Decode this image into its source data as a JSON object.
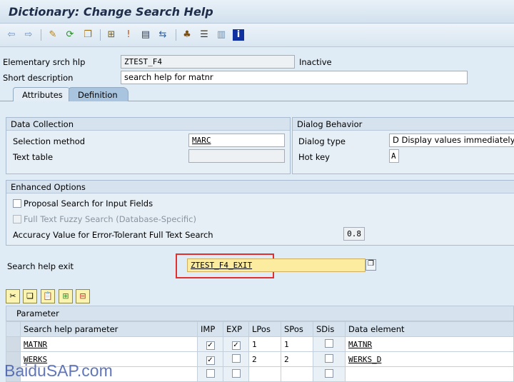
{
  "window": {
    "title": "Dictionary: Change Search Help"
  },
  "toolbar": {
    "icons": [
      "back-icon",
      "forward-icon",
      "edit-icon",
      "activate-icon",
      "copy-object-icon",
      "where-used-icon",
      "check-icon",
      "display-object-list-icon",
      "navigate-icon",
      "hierarchy-icon",
      "stack-icon",
      "layout-icon",
      "info-icon"
    ]
  },
  "header": {
    "name_label": "Elementary srch hlp",
    "name_value": "ZTEST_F4",
    "status": "Inactive",
    "desc_label": "Short description",
    "desc_value": "search help for matnr"
  },
  "tabs": [
    {
      "label": "Attributes",
      "active": false
    },
    {
      "label": "Definition",
      "active": true
    }
  ],
  "data_collection": {
    "title": "Data Collection",
    "selection_method_label": "Selection method",
    "selection_method_value": "MARC",
    "text_table_label": "Text table",
    "text_table_value": ""
  },
  "dialog_behavior": {
    "title": "Dialog Behavior",
    "dialog_type_label": "Dialog type",
    "dialog_type_value": "D Display values immediately",
    "hot_key_label": "Hot key",
    "hot_key_value": "A"
  },
  "enhanced_options": {
    "title": "Enhanced Options",
    "proposal_search_label": "Proposal Search for Input Fields",
    "fuzzy_search_label": "Full Text Fuzzy Search (Database-Specific)",
    "accuracy_label": "Accuracy Value for Error-Tolerant Full Text Search",
    "accuracy_value": "0.8"
  },
  "exit": {
    "label": "Search help exit",
    "value": "ZTEST_F4_EXIT",
    "highlight_color": "#e03030"
  },
  "param_toolbar": {
    "icons": [
      "cut-icon",
      "copy-icon",
      "paste-icon",
      "insert-row-icon",
      "delete-row-icon"
    ]
  },
  "parameters": {
    "title": "Parameter",
    "columns": [
      "Search help parameter",
      "IMP",
      "EXP",
      "LPos",
      "SPos",
      "SDis",
      "Data element"
    ],
    "rows": [
      {
        "name": "MATNR",
        "imp": true,
        "exp": true,
        "lpos": "1",
        "spos": "1",
        "sdis": false,
        "data_element": "MATNR"
      },
      {
        "name": "WERKS",
        "imp": true,
        "exp": false,
        "lpos": "2",
        "spos": "2",
        "sdis": false,
        "data_element": "WERKS_D"
      },
      {
        "name": "",
        "imp": false,
        "exp": false,
        "lpos": "",
        "spos": "",
        "sdis": false,
        "data_element": ""
      }
    ]
  },
  "watermark": "BaiduSAP.com"
}
